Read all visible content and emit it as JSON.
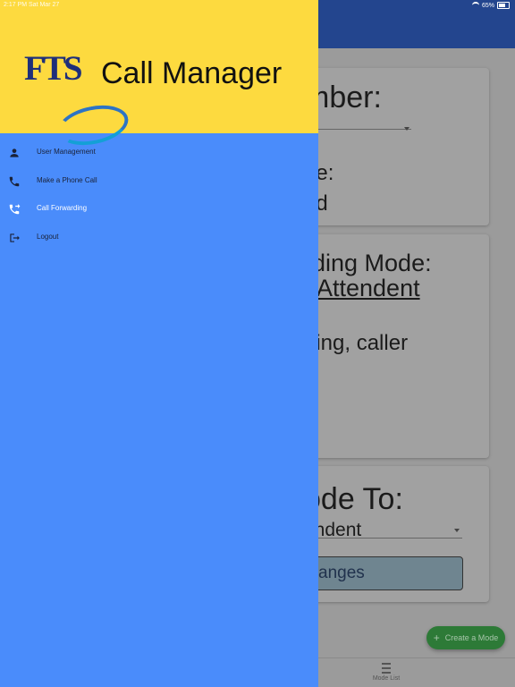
{
  "status_bar": {
    "time_date": "2:17 PM   Sat Mar 27",
    "battery": "65%"
  },
  "background": {
    "card1": {
      "line1": "mber:",
      "line2": "ne:",
      "line3": "nd"
    },
    "card2": {
      "line1": "rding Mode:",
      "line2": "Attendent",
      "line3": "ding, caller"
    },
    "card3": {
      "line1": "ode To:",
      "line2": "endent"
    },
    "save_button": "anges",
    "fab_label": "Create a Mode",
    "bottom_nav": {
      "label": "Mode List"
    }
  },
  "drawer": {
    "title": "Call Manager",
    "logo_letters": "FTS",
    "items": [
      {
        "label": "User Management",
        "icon": "person-icon"
      },
      {
        "label": "Make a Phone Call",
        "icon": "phone-icon"
      },
      {
        "label": "Call Forwarding",
        "icon": "phone-forward-icon"
      },
      {
        "label": "Logout",
        "icon": "logout-icon"
      }
    ],
    "colors": {
      "header": "#fdda3f",
      "body": "#4a8cfb",
      "active_text": "#ffffff"
    }
  }
}
